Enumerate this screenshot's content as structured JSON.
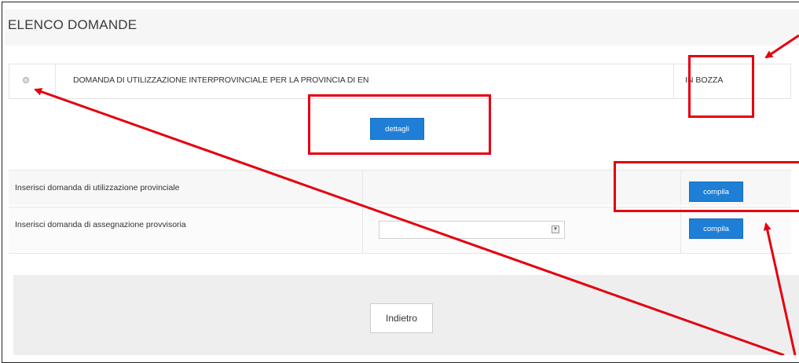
{
  "page": {
    "title": "ELENCO DOMANDE"
  },
  "application": {
    "title": "DOMANDA DI UTILIZZAZIONE INTERPROVINCIALE PER LA PROVINCIA DI EN",
    "status": "IN BOZZA",
    "details_button": "dettagli"
  },
  "forms": [
    {
      "label": "Inserisci domanda di utilizzazione provinciale",
      "button": "compila",
      "has_select": false
    },
    {
      "label": "Inserisci domanda di assegnazione provvisoria",
      "button": "compila",
      "has_select": true,
      "select_value": ""
    }
  ],
  "footer": {
    "back_button": "Indietro"
  },
  "annotation_color": "#e4000f"
}
